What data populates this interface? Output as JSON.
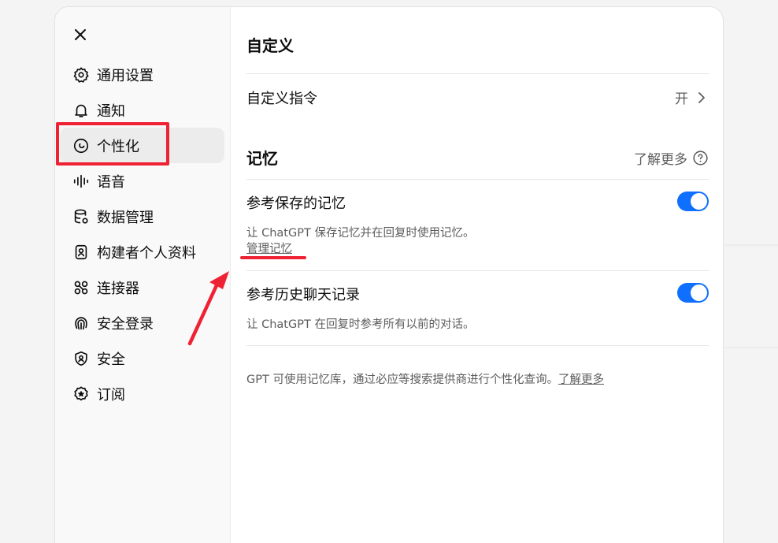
{
  "sidebar": {
    "items": [
      {
        "label": "通用设置",
        "icon": "gear-icon"
      },
      {
        "label": "通知",
        "icon": "bell-icon"
      },
      {
        "label": "个性化",
        "icon": "personalization-icon"
      },
      {
        "label": "语音",
        "icon": "voice-waveform-icon"
      },
      {
        "label": "数据管理",
        "icon": "database-icon"
      },
      {
        "label": "构建者个人资料",
        "icon": "profile-card-icon"
      },
      {
        "label": "连接器",
        "icon": "connectors-icon"
      },
      {
        "label": "安全登录",
        "icon": "fingerprint-icon"
      },
      {
        "label": "安全",
        "icon": "shield-icon"
      },
      {
        "label": "订阅",
        "icon": "badge-star-icon"
      }
    ],
    "active_index": 2
  },
  "customize": {
    "title": "自定义",
    "instructions_label": "自定义指令",
    "instructions_value": "开"
  },
  "memory": {
    "title": "记忆",
    "learn_more": "了解更多",
    "saved_memories": {
      "label": "参考保存的记忆",
      "description": "让 ChatGPT 保存记忆并在回复时使用记忆。",
      "manage_link": "管理记忆",
      "enabled": true
    },
    "chat_history": {
      "label": "参考历史聊天记录",
      "description": "让 ChatGPT 在回复时参考所有以前的对话。",
      "enabled": true
    }
  },
  "footer": {
    "note": "GPT 可使用记忆库，通过必应等搜索提供商进行个性化查询。",
    "learn_more": "了解更多"
  },
  "colors": {
    "accent": "#0f6fff",
    "annotation": "#ee2233"
  }
}
